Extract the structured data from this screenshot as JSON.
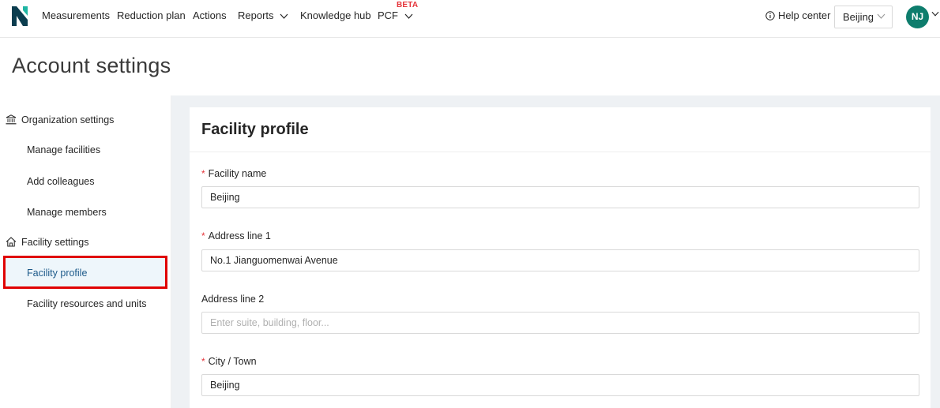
{
  "nav": {
    "items": [
      "Measurements",
      "Reduction plan",
      "Actions",
      "Reports",
      "Knowledge hub",
      "PCF"
    ],
    "beta_label": "BETA",
    "help_label": "Help center",
    "facility_selector": "Beijing",
    "avatar_initials": "NJ"
  },
  "page": {
    "title": "Account settings"
  },
  "sidebar": {
    "org_group": "Organization settings",
    "org_items": [
      "Manage facilities",
      "Add colleagues",
      "Manage members"
    ],
    "facility_group": "Facility settings",
    "facility_items": [
      "Facility profile",
      "Facility resources and units"
    ]
  },
  "form": {
    "title": "Facility profile",
    "required_mark": "*",
    "fields": [
      {
        "label": "Facility name",
        "required": true,
        "value": "Beijing",
        "placeholder": ""
      },
      {
        "label": "Address line 1",
        "required": true,
        "value": "No.1 Jianguomenwai Avenue",
        "placeholder": ""
      },
      {
        "label": "Address line 2",
        "required": false,
        "value": "",
        "placeholder": "Enter suite, building, floor..."
      },
      {
        "label": "City / Town",
        "required": true,
        "value": "Beijing",
        "placeholder": ""
      }
    ]
  },
  "colors": {
    "brand_teal": "#0e7d6d",
    "highlight_red": "#e00000",
    "required_red": "#e5343a"
  }
}
